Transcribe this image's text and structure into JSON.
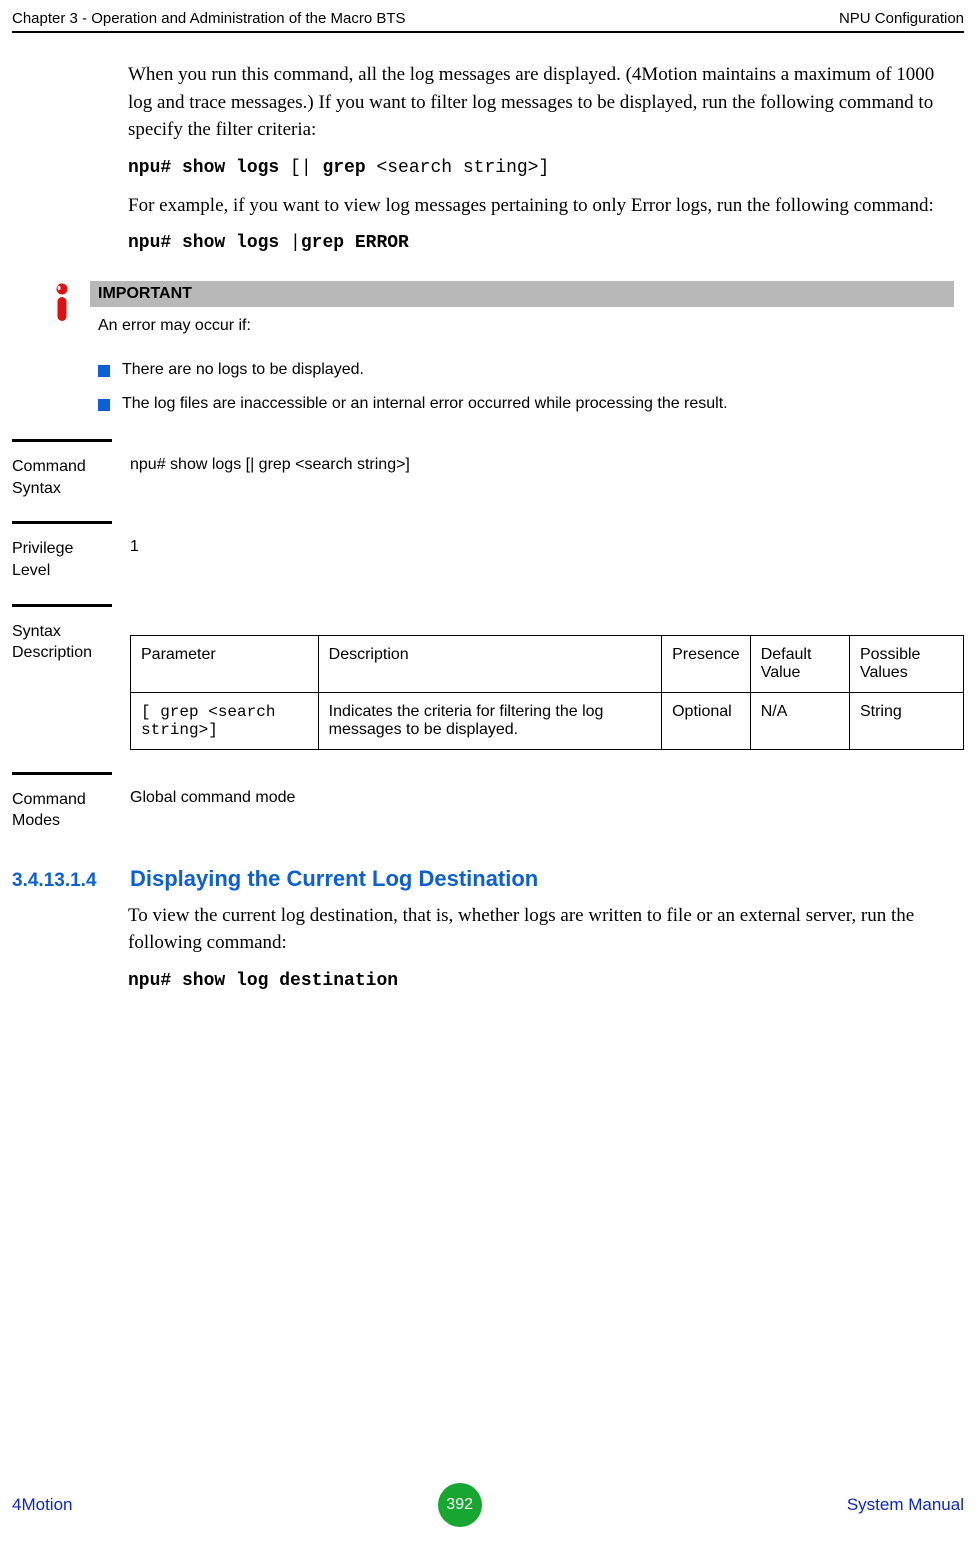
{
  "header": {
    "left": "Chapter 3 - Operation and Administration of the Macro BTS",
    "right": "NPU Configuration"
  },
  "body": {
    "para1": "When you run this command, all the log messages are displayed. (4Motion maintains a maximum of 1000 log and trace messages.) If you want to filter log messages to be displayed, run the following command to specify the filter criteria:",
    "cmd1_b1": "npu# show logs ",
    "cmd1_p1": "[| ",
    "cmd1_b2": "grep ",
    "cmd1_p2": "<search string>]",
    "para2": "For example, if you want to view log messages pertaining to only Error logs, run the following command:",
    "cmd2_b1": "npu# show logs ",
    "cmd2_p1": "|",
    "cmd2_b2": "grep ERROR"
  },
  "important": {
    "label": "IMPORTANT",
    "intro": "An error may occur if:",
    "bullets": [
      "There are no logs to be displayed.",
      "The log files are inaccessible or an internal error occurred while processing the result."
    ]
  },
  "sections": {
    "command_syntax": {
      "label": "Command Syntax",
      "value": "npu# show logs [| grep <search string>]"
    },
    "privilege_level": {
      "label": "Privilege Level",
      "value": "1"
    },
    "syntax_description": {
      "label": "Syntax Description",
      "headers": {
        "parameter": "Parameter",
        "description": "Description",
        "presence": "Presence",
        "default_value": "Default Value",
        "possible_values": "Possible Values"
      },
      "rows": [
        {
          "parameter": "[ grep <search string>]",
          "description": "Indicates the criteria for filtering the log messages to be displayed.",
          "presence": "Optional",
          "default_value": "N/A",
          "possible_values": "String"
        }
      ]
    },
    "command_modes": {
      "label": "Command Modes",
      "value": "Global command mode"
    }
  },
  "subheading": {
    "number": "3.4.13.1.4",
    "title": "Displaying the Current Log Destination",
    "para": "To view the current log destination, that is, whether logs are written to file or an external server, run the following command:",
    "cmd": "npu# show log destination"
  },
  "footer": {
    "left": "4Motion",
    "page": "392",
    "right": "System Manual"
  }
}
